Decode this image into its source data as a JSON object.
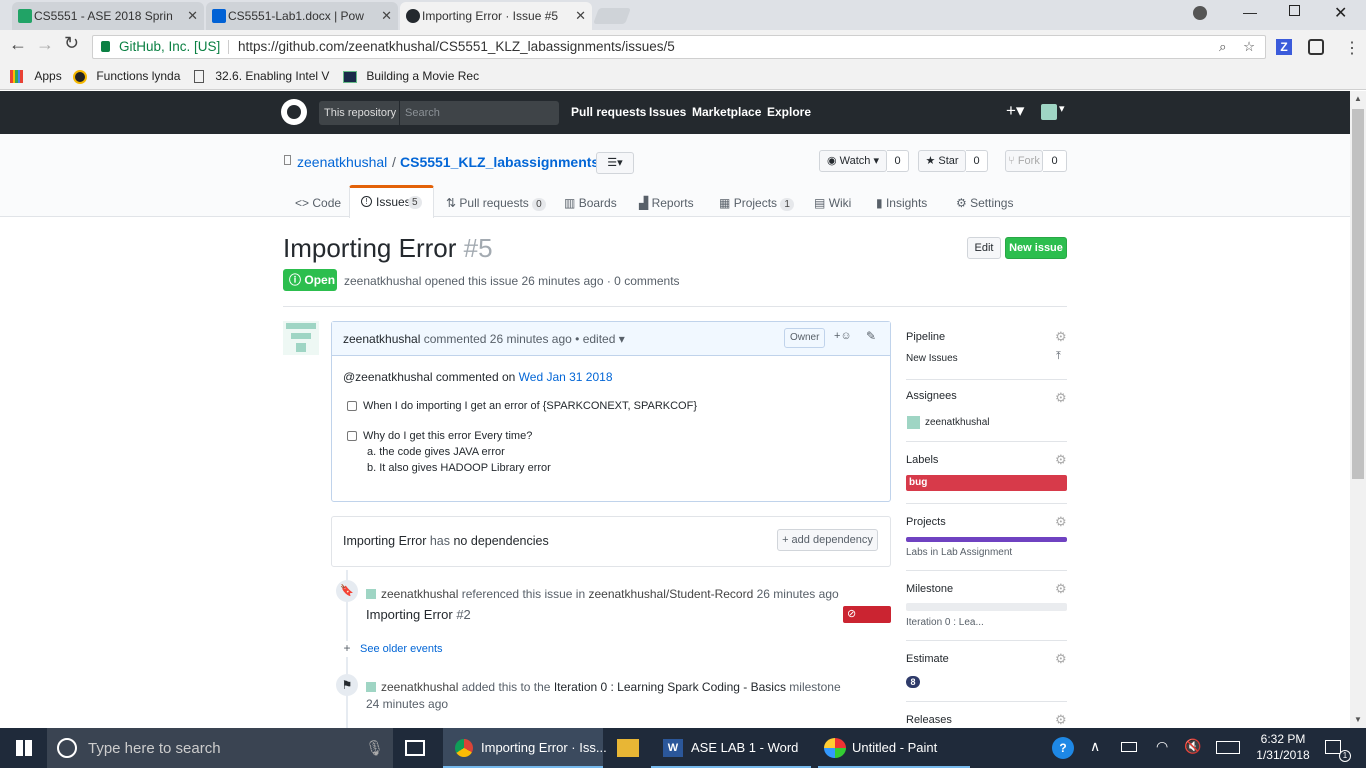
{
  "browser": {
    "tabs": [
      {
        "label": "CS5551 - ASE 2018 Sprin",
        "icon": "sheets-icon",
        "color": "#21a366"
      },
      {
        "label": "CS5551-Lab1.docx | Pow",
        "icon": "box-icon",
        "color": "#0061d5"
      },
      {
        "label": "Importing Error · Issue #5",
        "icon": "github-icon",
        "color": "#24292e"
      }
    ],
    "secure_label": "GitHub, Inc. [US]",
    "url": "https://github.com/zeenatkhushal/CS5551_KLZ_labassignments/issues/5",
    "bookmarks": [
      {
        "label": "Apps",
        "icon": "apps-icon"
      },
      {
        "label": "Functions lynda",
        "icon": "lynda-icon"
      },
      {
        "label": "32.6. Enabling Intel V",
        "icon": "page-icon"
      },
      {
        "label": "Building a Movie Rec",
        "icon": "video-icon"
      }
    ]
  },
  "github": {
    "scope_label": "This repository",
    "search_placeholder": "Search",
    "nav": [
      "Pull requests",
      "Issues",
      "Marketplace",
      "Explore"
    ],
    "owner": "zeenatkhushal",
    "separator": "/",
    "repo": "CS5551_KLZ_labassignments",
    "watch": {
      "label": "Watch",
      "count": "0"
    },
    "star": {
      "label": "Star",
      "count": "0"
    },
    "fork": {
      "label": "Fork",
      "count": "0"
    },
    "repo_tabs": [
      {
        "label": "Code",
        "icon": "<>"
      },
      {
        "label": "Issues",
        "count": "5",
        "icon": "!"
      },
      {
        "label": "Pull requests",
        "count": "0",
        "icon": "⇅"
      },
      {
        "label": "Boards",
        "icon": "▥"
      },
      {
        "label": "Reports",
        "icon": "▟"
      },
      {
        "label": "Projects",
        "count": "1",
        "icon": "▦"
      },
      {
        "label": "Wiki",
        "icon": "▤"
      },
      {
        "label": "Insights",
        "icon": "▮"
      },
      {
        "label": "Settings",
        "icon": "⚙"
      }
    ]
  },
  "issue": {
    "title": "Importing Error",
    "number": "#5",
    "edit_label": "Edit",
    "new_issue_label": "New issue",
    "state": "Open",
    "author": "zeenatkhushal",
    "meta": "opened this issue 26 minutes ago · 0 comments",
    "comment": {
      "author": "zeenatkhushal",
      "meta": "commented 26 minutes ago • edited",
      "role": "Owner",
      "quote_author": "@zeenatkhushal",
      "quote_mid": "commented on",
      "quote_date": "Wed Jan 31 2018",
      "task1": "When I do importing I get an error of {SPARKCONEXT, SPARKCOF}",
      "task2": "Why do I get this error Every time?",
      "sub_a": "a. the code gives JAVA error",
      "sub_b": "b. It also gives HADOOP Library error"
    },
    "deps": {
      "title": "Importing Error",
      "has": "has",
      "none": "no dependencies",
      "add": "+ add dependency"
    },
    "events": {
      "ref_author": "zeenatkhushal",
      "ref_text": "referenced this issue in",
      "ref_repo": "zeenatkhushal/Student-Record",
      "ref_time": "26 minutes ago",
      "ref_title": "Importing Error",
      "ref_number": "#2",
      "ref_state": "Closed",
      "older": "See older events",
      "ms_author": "zeenatkhushal",
      "ms_text": "added this to the",
      "ms_name": "Iteration 0 : Learning Spark Coding - Basics",
      "ms_suffix": "milestone",
      "ms_time": "24 minutes ago"
    }
  },
  "sidebar": {
    "pipeline": {
      "label": "Pipeline",
      "value": "New Issues"
    },
    "assignees": {
      "label": "Assignees",
      "value": "zeenatkhushal"
    },
    "labels": {
      "label": "Labels",
      "value": "bug",
      "color": "#d73a4a"
    },
    "projects": {
      "label": "Projects",
      "value": "Labs in Lab Assignment",
      "color": "#6f42c1"
    },
    "milestone": {
      "label": "Milestone",
      "value": "Iteration 0 : Lea...",
      "progress": 0
    },
    "estimate": {
      "label": "Estimate",
      "value": "8"
    },
    "releases": {
      "label": "Releases"
    }
  },
  "taskbar": {
    "search_placeholder": "Type here to search",
    "apps": [
      {
        "label": "Importing Error · Iss..."
      },
      {
        "label": "ASE LAB 1 - Word"
      },
      {
        "label": "Untitled - Paint"
      }
    ],
    "time": "6:32 PM",
    "date": "1/31/2018",
    "notifications": "1"
  }
}
